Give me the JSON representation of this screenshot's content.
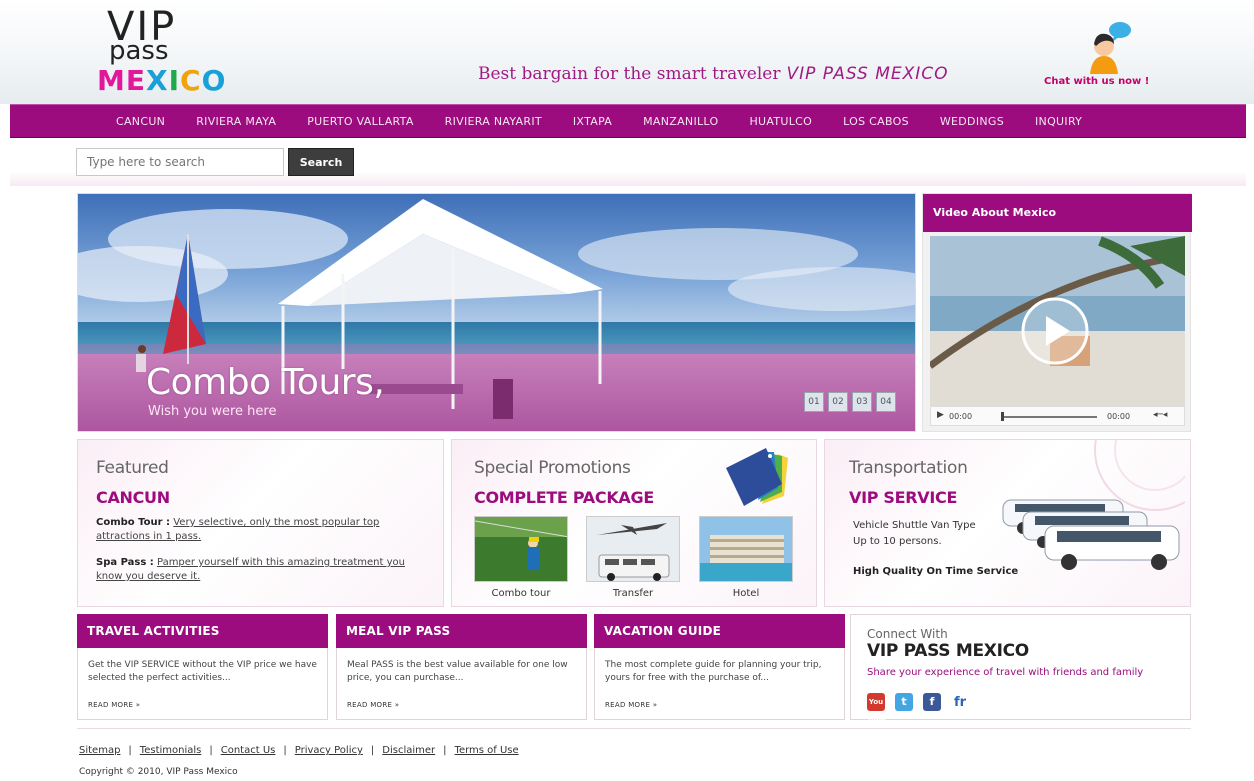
{
  "header": {
    "logo": {
      "line1": "VIP",
      "line2": "pass",
      "line3_letters": [
        "M",
        "E",
        "X",
        "I",
        "C",
        "O"
      ],
      "line3_colors": [
        "#e2179b",
        "#e2179b",
        "#1aa0d8",
        "#20a84a",
        "#f0a30a",
        "#1aa0d8"
      ]
    },
    "tagline": "Best bargain for the smart traveler",
    "tagline_brand": "VIP PASS MEXICO",
    "chat_label": "Chat with us now !"
  },
  "nav": {
    "items": [
      "CANCUN",
      "RIVIERA MAYA",
      "PUERTO VALLARTA",
      "RIVIERA NAYARIT",
      "IXTAPA",
      "MANZANILLO",
      "HUATULCO",
      "LOS CABOS",
      "WEDDINGS",
      "INQUIRY"
    ]
  },
  "search": {
    "placeholder": "Type here to search",
    "button_label": "Search"
  },
  "hero": {
    "title": "Combo Tours,",
    "subtitle": "Wish you were here",
    "slides": [
      "01",
      "02",
      "03",
      "04"
    ]
  },
  "video": {
    "title": "Video About Mexico",
    "time_current": "00:00",
    "time_total": "00:00"
  },
  "featured": {
    "heading": "Featured",
    "subheading": "CANCUN",
    "items": [
      {
        "label": "Combo Tour :",
        "text": "Very selective, only the most popular top attractions in 1 pass."
      },
      {
        "label": "Spa Pass :",
        "text": "Pamper yourself with this amazing treatment you know you deserve it."
      }
    ]
  },
  "promotions": {
    "heading": "Special Promotions",
    "subheading": "COMPLETE PACKAGE",
    "thumbs": [
      "Combo tour",
      "Transfer",
      "Hotel"
    ]
  },
  "transportation": {
    "heading": "Transportation",
    "subheading": "VIP SERVICE",
    "line1": "Vehicle Shuttle Van Type",
    "line2": "Up to 10 persons.",
    "highlight": "High Quality On Time Service"
  },
  "boxes": [
    {
      "title": "TRAVEL ACTIVITIES",
      "text": "Get the VIP SERVICE without the VIP price we have selected the perfect activities...",
      "more": "READ MORE »"
    },
    {
      "title": "MEAL VIP PASS",
      "text": "Meal PASS is the best value available for one low price, you can purchase...",
      "more": "READ MORE »"
    },
    {
      "title": "VACATION GUIDE",
      "text": "The most complete guide for planning your trip, yours for free with the purchase of...",
      "more": "READ MORE »"
    }
  ],
  "connect": {
    "heading": "Connect With",
    "brand": "VIP PASS MEXICO",
    "text": "Share your experience of travel with friends and family",
    "social": [
      "You Tube",
      "t",
      "f",
      "fr"
    ]
  },
  "footer": {
    "links": [
      "Sitemap",
      "Testimonials",
      "Contact Us",
      "Privacy Policy",
      "Disclaimer",
      "Terms of Use"
    ],
    "separator": "|",
    "copyright": "Copyright © 2010, VIP Pass Mexico"
  },
  "colors": {
    "brand": "#9c0c7e",
    "accent_pink": "#e2179b"
  }
}
